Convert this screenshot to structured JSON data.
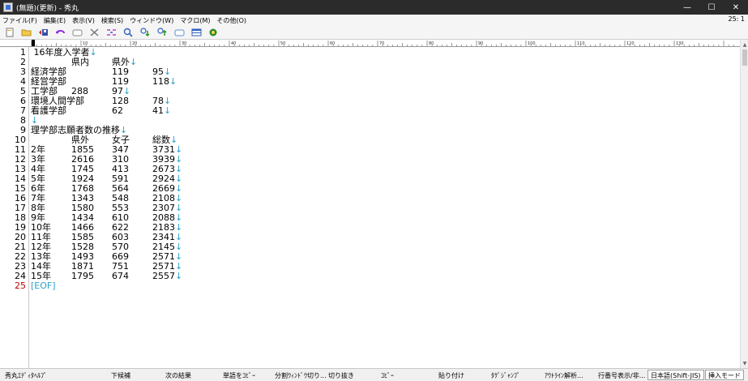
{
  "window": {
    "title": "(無題)(更新) - 秀丸",
    "minimize_glyph": "—",
    "maximize_glyph": "☐",
    "close_glyph": "✕"
  },
  "menu": {
    "items": [
      "ファイル(F)",
      "編集(E)",
      "表示(V)",
      "検索(S)",
      "ウィンドウ(W)",
      "マクロ(M)",
      "その他(O)"
    ],
    "cursor_position": "25: 1"
  },
  "toolbar": {
    "icons": [
      "new-file-icon",
      "open-folder-icon",
      "save-icon",
      "undo-icon",
      "cut-icon",
      "copy-icon",
      "paste-icon",
      "search-icon",
      "find-next-icon",
      "find-prev-icon",
      "grep-icon",
      "window-icon",
      "help-icon"
    ]
  },
  "ruler": {
    "labels": [
      "10",
      "20",
      "30",
      "40",
      "50",
      "60",
      "70",
      "80",
      "90",
      "100",
      "110",
      "120",
      "130"
    ]
  },
  "editor": {
    "newline_mark": "↓",
    "lines": [
      {
        "n": "1",
        "cells": [
          " 16年度入学者"
        ],
        "nl": true
      },
      {
        "n": "2",
        "cells": [
          "",
          "県内",
          "県外"
        ],
        "nl": true
      },
      {
        "n": "3",
        "cells": [
          "経済学部",
          "",
          "119",
          "95"
        ],
        "nl": true
      },
      {
        "n": "4",
        "cells": [
          "経営学部",
          "",
          "119",
          "118"
        ],
        "nl": true
      },
      {
        "n": "5",
        "cells": [
          "工学部",
          "288",
          "97"
        ],
        "nl": true
      },
      {
        "n": "6",
        "cells": [
          "環境人間学部",
          "",
          "128",
          "78"
        ],
        "nl": true
      },
      {
        "n": "7",
        "cells": [
          "看護学部",
          "",
          "62",
          "41"
        ],
        "nl": true
      },
      {
        "n": "8",
        "cells": [
          ""
        ],
        "nl": true
      },
      {
        "n": "9",
        "cells": [
          "理学部志願者数の推移"
        ],
        "nl": true
      },
      {
        "n": "10",
        "cells": [
          "",
          "県外",
          "女子",
          "総数"
        ],
        "nl": true
      },
      {
        "n": "11",
        "cells": [
          "2年",
          "1855",
          "347",
          "3731"
        ],
        "nl": true
      },
      {
        "n": "12",
        "cells": [
          "3年",
          "2616",
          "310",
          "3939"
        ],
        "nl": true
      },
      {
        "n": "13",
        "cells": [
          "4年",
          "1745",
          "413",
          "2673"
        ],
        "nl": true
      },
      {
        "n": "14",
        "cells": [
          "5年",
          "1924",
          "591",
          "2924"
        ],
        "nl": true
      },
      {
        "n": "15",
        "cells": [
          "6年",
          "1768",
          "564",
          "2669"
        ],
        "nl": true
      },
      {
        "n": "16",
        "cells": [
          "7年",
          "1343",
          "548",
          "2108"
        ],
        "nl": true
      },
      {
        "n": "17",
        "cells": [
          "8年",
          "1580",
          "553",
          "2307"
        ],
        "nl": true
      },
      {
        "n": "18",
        "cells": [
          "9年",
          "1434",
          "610",
          "2088"
        ],
        "nl": true
      },
      {
        "n": "19",
        "cells": [
          "10年",
          "1466",
          "622",
          "2183"
        ],
        "nl": true
      },
      {
        "n": "20",
        "cells": [
          "11年",
          "1585",
          "603",
          "2341"
        ],
        "nl": true
      },
      {
        "n": "21",
        "cells": [
          "12年",
          "1528",
          "570",
          "2145"
        ],
        "nl": true
      },
      {
        "n": "22",
        "cells": [
          "13年",
          "1493",
          "669",
          "2571"
        ],
        "nl": true
      },
      {
        "n": "23",
        "cells": [
          "14年",
          "1871",
          "751",
          "2571"
        ],
        "nl": true
      },
      {
        "n": "24",
        "cells": [
          "15年",
          "1795",
          "674",
          "2557"
        ],
        "nl": true
      }
    ],
    "eof_line": {
      "n": "25",
      "text": "[EOF]"
    }
  },
  "statusbar": {
    "keys": [
      "秀丸ｴﾃﾞｨﾀﾍﾙﾌﾟ",
      "下候補",
      "次の結果",
      "単語をｺﾋﾟｰ",
      "分割ｳｨﾝﾄﾞｳ切り...",
      "切り抜き",
      "ｺﾋﾟｰ",
      "貼り付け",
      "ﾀｸﾞｼﾞｬﾝﾌﾟ",
      "ｱｳﾄﾗｲﾝ解析...",
      "行番号表示/非..."
    ],
    "encoding": "日本語(Shift-JIS)",
    "mode": "挿入モード"
  }
}
